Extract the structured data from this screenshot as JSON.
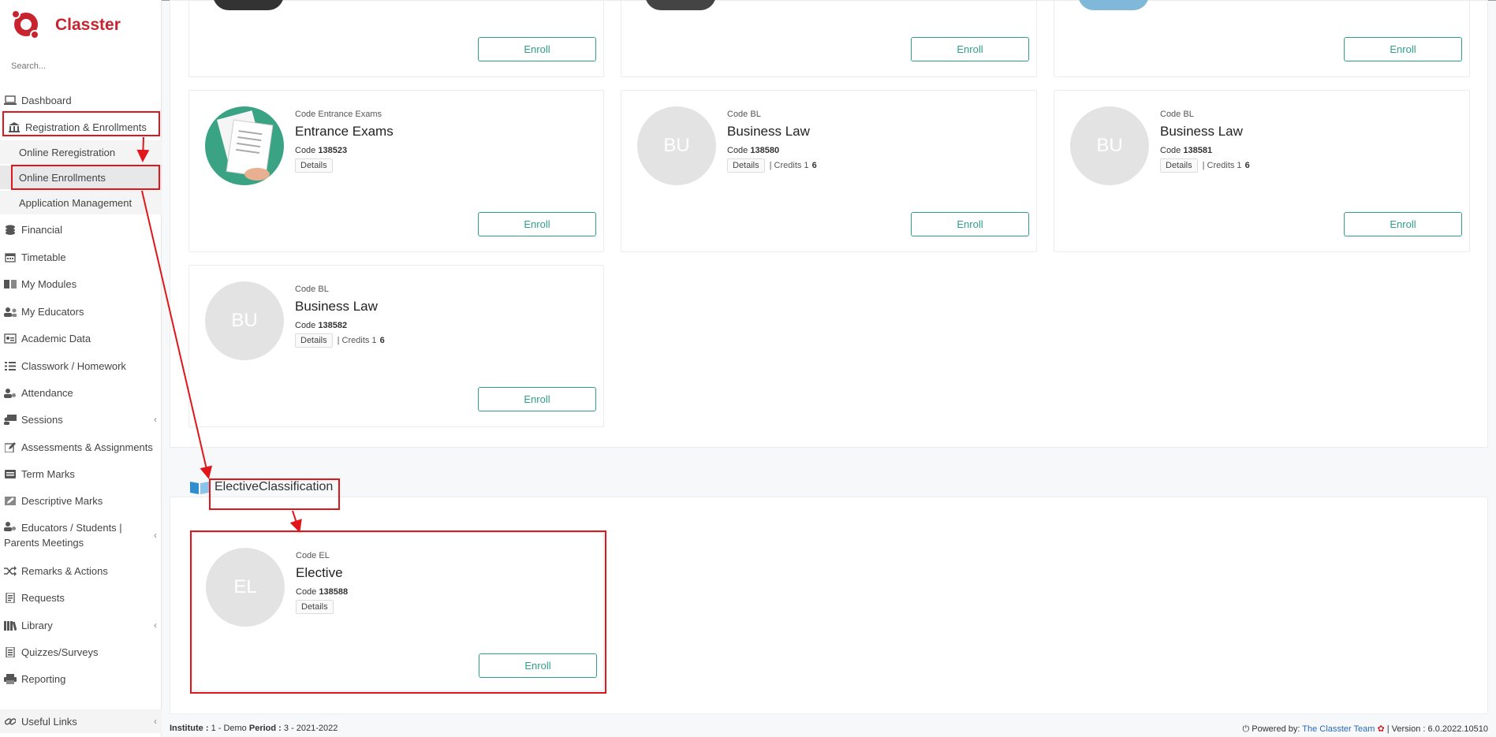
{
  "app": {
    "name": "Classter"
  },
  "search": {
    "placeholder": "Search..."
  },
  "sidebar": {
    "items": [
      {
        "label": "Dashboard",
        "icon": "laptop-icon"
      },
      {
        "label": "Registration & Enrollments",
        "icon": "bank-icon"
      },
      {
        "label": "Online Reregistration"
      },
      {
        "label": "Online Enrollments"
      },
      {
        "label": "Application Management"
      },
      {
        "label": "Financial",
        "icon": "coins-icon"
      },
      {
        "label": "Timetable",
        "icon": "calendar-icon"
      },
      {
        "label": "My Modules",
        "icon": "book-icon"
      },
      {
        "label": "My Educators",
        "icon": "users-icon"
      },
      {
        "label": "Academic Data",
        "icon": "id-card-icon"
      },
      {
        "label": "Classwork / Homework",
        "icon": "list-check-icon"
      },
      {
        "label": "Attendance",
        "icon": "user-check-icon"
      },
      {
        "label": "Sessions",
        "icon": "presentation-icon"
      },
      {
        "label": "Assessments & Assignments",
        "icon": "edit-icon"
      },
      {
        "label": "Term Marks",
        "icon": "term-icon"
      },
      {
        "label": "Descriptive Marks",
        "icon": "marks-icon"
      },
      {
        "label": "Educators / Students |",
        "label2": "Parents Meetings",
        "icon": "meeting-icon"
      },
      {
        "label": "Remarks & Actions",
        "icon": "shuffle-icon"
      },
      {
        "label": "Requests",
        "icon": "request-icon"
      },
      {
        "label": "Library",
        "icon": "library-icon"
      },
      {
        "label": "Quizzes/Surveys",
        "icon": "quiz-icon"
      },
      {
        "label": "Reporting",
        "icon": "printer-icon"
      },
      {
        "label": "Useful Links",
        "icon": "link-icon"
      }
    ]
  },
  "cards": {
    "enroll_label": "Enroll",
    "details_label": "Details",
    "entrance": {
      "code_top": "Code Entrance Exams",
      "title": "Entrance Exams",
      "code_prefix": "Code",
      "code": "138523"
    },
    "bl1": {
      "initials": "BU",
      "code_top": "Code BL",
      "title": "Business Law",
      "code_prefix": "Code",
      "code": "138580",
      "credits_label": "| Credits 1",
      "credits": "6"
    },
    "bl2": {
      "initials": "BU",
      "code_top": "Code BL",
      "title": "Business Law",
      "code_prefix": "Code",
      "code": "138581",
      "credits_label": "| Credits 1",
      "credits": "6"
    },
    "bl3": {
      "initials": "BU",
      "code_top": "Code BL",
      "title": "Business Law",
      "code_prefix": "Code",
      "code": "138582",
      "credits_label": "| Credits 1",
      "credits": "6"
    },
    "el": {
      "initials": "EL",
      "code_top": "Code EL",
      "title": "Elective",
      "code_prefix": "Code",
      "code": "138588"
    }
  },
  "section": {
    "title": "ElectiveClassification"
  },
  "footer": {
    "institute_label": "Institute :",
    "institute_value": "1 - Demo",
    "period_label": "Period :",
    "period_value": "3 - 2021-2022",
    "powered_label": "Powered by:",
    "powered_link": "The Classter Team",
    "version": "| Version : 6.0.2022.10510"
  },
  "colors": {
    "brand": "#c8242f",
    "accent": "#2e9e8a",
    "annotation": "#e0161b"
  }
}
